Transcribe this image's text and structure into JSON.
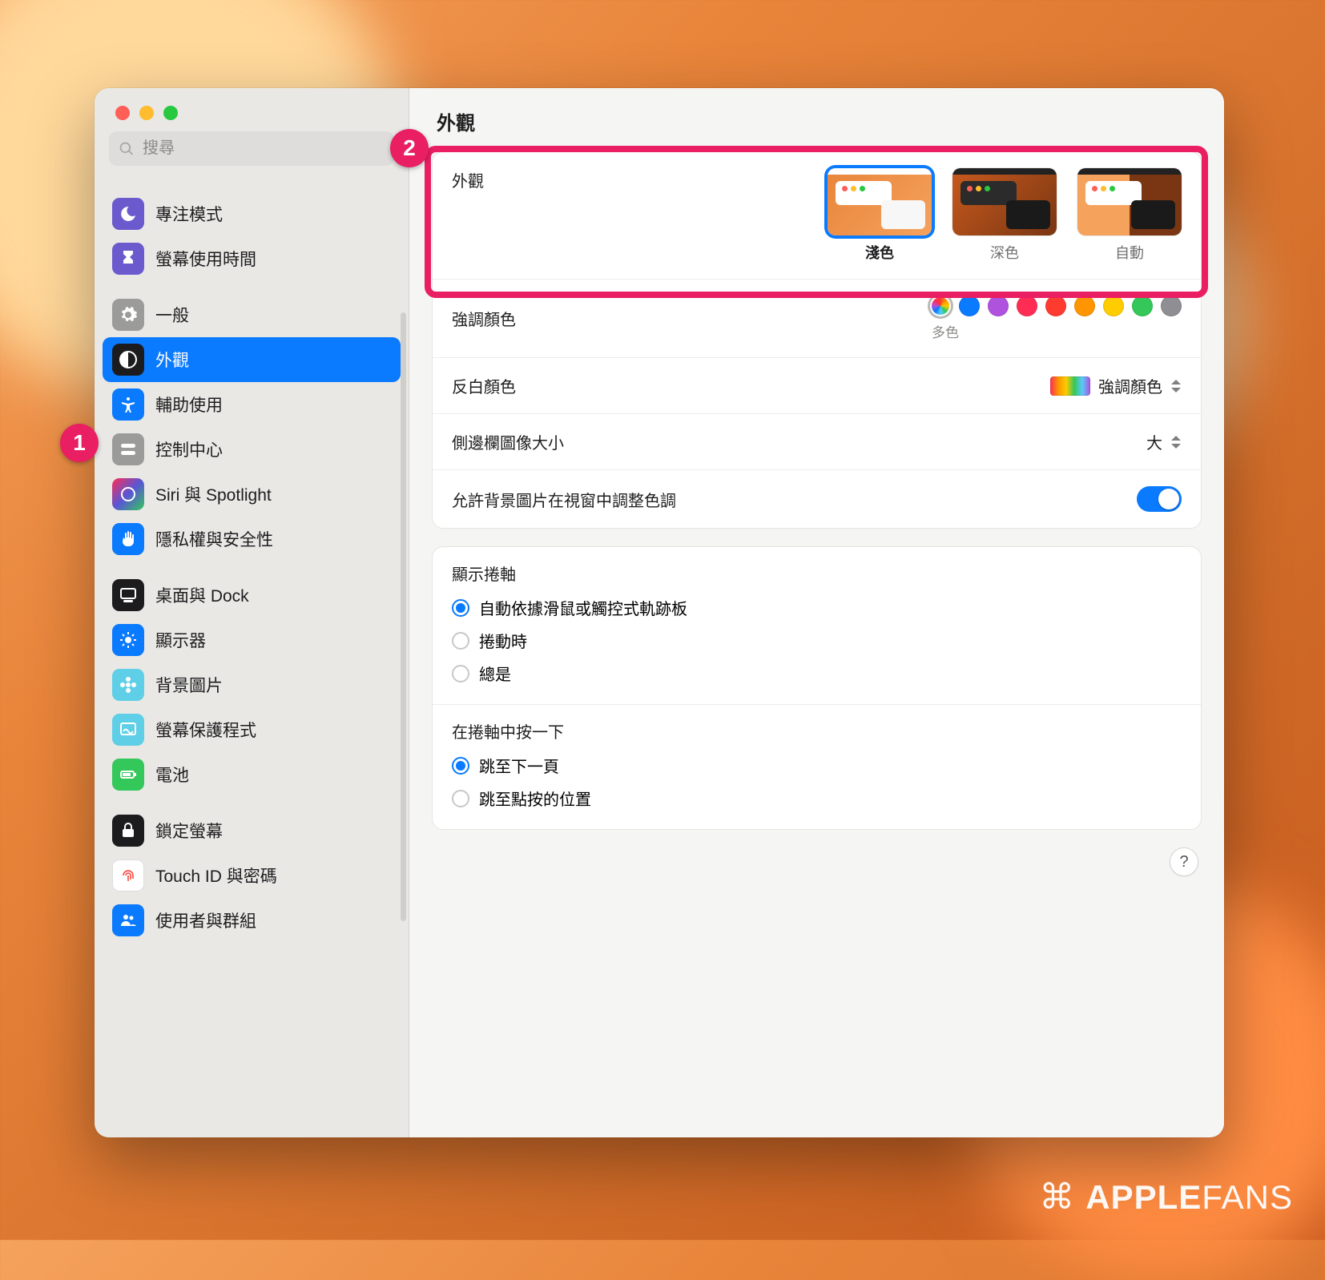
{
  "window_title": "外觀",
  "search": {
    "placeholder": "搜尋"
  },
  "sidebar": {
    "items": [
      {
        "id": "focus",
        "label": "專注模式",
        "icon": "moon",
        "bg": "#6a5acd"
      },
      {
        "id": "screen-time",
        "label": "螢幕使用時間",
        "icon": "hourglass",
        "bg": "#6a5acd"
      },
      {
        "id": "general",
        "label": "一般",
        "icon": "gear",
        "bg": "#9b9b99"
      },
      {
        "id": "appearance",
        "label": "外觀",
        "icon": "contrast",
        "bg": "#1c1c1e",
        "selected": true
      },
      {
        "id": "accessibility",
        "label": "輔助使用",
        "icon": "person",
        "bg": "#0a7aff"
      },
      {
        "id": "control-center",
        "label": "控制中心",
        "icon": "switches",
        "bg": "#9b9b99"
      },
      {
        "id": "siri-spotlight",
        "label": "Siri 與 Spotlight",
        "icon": "siri",
        "bg": "#1c1c1e"
      },
      {
        "id": "privacy",
        "label": "隱私權與安全性",
        "icon": "hand",
        "bg": "#0a7aff"
      },
      {
        "id": "desktop-dock",
        "label": "桌面與 Dock",
        "icon": "dock",
        "bg": "#1c1c1e"
      },
      {
        "id": "displays",
        "label": "顯示器",
        "icon": "sun",
        "bg": "#0a7aff"
      },
      {
        "id": "wallpaper",
        "label": "背景圖片",
        "icon": "flower",
        "bg": "#5ecfe6"
      },
      {
        "id": "screensaver",
        "label": "螢幕保護程式",
        "icon": "screensaver",
        "bg": "#5ecfe6"
      },
      {
        "id": "battery",
        "label": "電池",
        "icon": "battery",
        "bg": "#34c759"
      },
      {
        "id": "lock-screen",
        "label": "鎖定螢幕",
        "icon": "lock",
        "bg": "#1c1c1e"
      },
      {
        "id": "touchid",
        "label": "Touch ID 與密碼",
        "icon": "fingerprint",
        "bg": "#ffffff"
      },
      {
        "id": "users",
        "label": "使用者與群組",
        "icon": "users",
        "bg": "#0a7aff"
      }
    ]
  },
  "main": {
    "appearance_label": "外觀",
    "appearance_options": [
      {
        "key": "light",
        "label": "淺色",
        "selected": true
      },
      {
        "key": "dark",
        "label": "深色"
      },
      {
        "key": "auto",
        "label": "自動"
      }
    ],
    "accent_label": "強調顏色",
    "accent_selected_label": "多色",
    "accent_colors": [
      "multi",
      "#0a7aff",
      "#af52de",
      "#ff2d55",
      "#ff3b30",
      "#ff9500",
      "#ffcc00",
      "#34c759",
      "#8e8e93"
    ],
    "highlight_label": "反白顏色",
    "highlight_value": "強調顏色",
    "sidebar_icon_size_label": "側邊欄圖像大小",
    "sidebar_icon_size_value": "大",
    "wallpaper_tint_label": "允許背景圖片在視窗中調整色調",
    "wallpaper_tint_on": true,
    "scrollbar": {
      "title": "顯示捲軸",
      "options": [
        {
          "label": "自動依據滑鼠或觸控式軌跡板",
          "checked": true
        },
        {
          "label": "捲動時"
        },
        {
          "label": "總是"
        }
      ]
    },
    "scrollbar_click": {
      "title": "在捲軸中按一下",
      "options": [
        {
          "label": "跳至下一頁",
          "checked": true
        },
        {
          "label": "跳至點按的位置"
        }
      ]
    },
    "help_tooltip": "?"
  },
  "annotations": {
    "badge1": "1",
    "badge2": "2"
  },
  "watermark": {
    "brand_bold": "APPLE",
    "brand_light": "FANS"
  }
}
